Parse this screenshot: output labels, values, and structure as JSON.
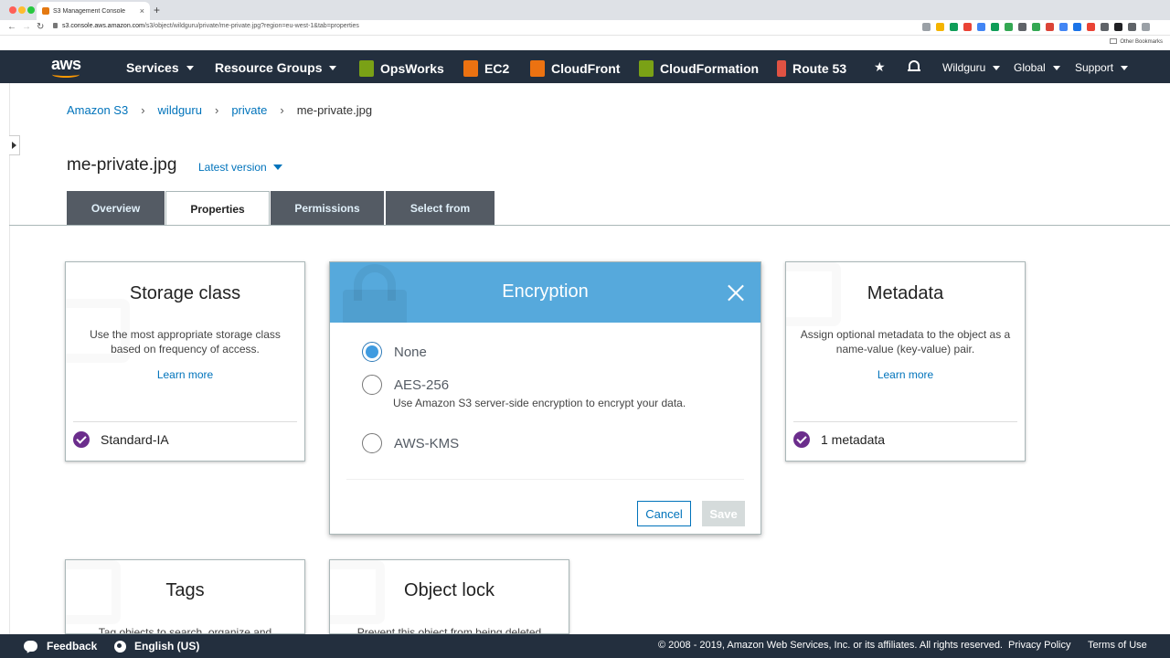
{
  "browser": {
    "tab_title": "S3 Management Console",
    "tab_close": "×",
    "new_tab": "+",
    "url_host": "s3.console.aws.amazon.com",
    "url_path": "/s3/object/wildguru/private/me-private.jpg?region=eu-west-1&tab=properties",
    "other_bookmarks": "Other Bookmarks",
    "extension_colors": [
      "#9aa0a6",
      "#f4b400",
      "#0f9d58",
      "#ea4335",
      "#4285f4",
      "#0f9d58",
      "#34a853",
      "#5f6368",
      "#34a853",
      "#db4437",
      "#4285f4",
      "#1a73e8",
      "#ea4335",
      "#5f6368",
      "#202124",
      "#5f6368",
      "#9aa0a6"
    ]
  },
  "aws_nav": {
    "logo": "aws",
    "items": [
      {
        "label": "Services",
        "caret": true
      },
      {
        "label": "Resource Groups",
        "caret": true
      },
      {
        "label": "OpsWorks",
        "icon": "opsworks-icon",
        "color": "#7aa116"
      },
      {
        "label": "EC2",
        "icon": "ec2-icon",
        "color": "#ec7211"
      },
      {
        "label": "CloudFront",
        "icon": "cloudfront-icon",
        "color": "#ec7211"
      },
      {
        "label": "CloudFormation",
        "icon": "cloudformation-icon",
        "color": "#7aa116"
      },
      {
        "label": "Route 53",
        "icon": "route53-icon",
        "color": "#e05243"
      }
    ],
    "account": "Wildguru",
    "region": "Global",
    "support": "Support"
  },
  "breadcrumb": {
    "items": [
      "Amazon S3",
      "wildguru",
      "private"
    ],
    "separator": "›",
    "current": "me-private.jpg"
  },
  "object": {
    "name": "me-private.jpg",
    "version": "Latest version"
  },
  "tabs": [
    {
      "label": "Overview",
      "active": false
    },
    {
      "label": "Properties",
      "active": true
    },
    {
      "label": "Permissions",
      "active": false
    },
    {
      "label": "Select from",
      "active": false
    }
  ],
  "storage_class": {
    "title": "Storage class",
    "description": "Use the most appropriate storage class based on frequency of access.",
    "link": "Learn more",
    "status": "Standard-IA"
  },
  "metadata": {
    "title": "Metadata",
    "description": "Assign optional metadata to the object as a name-value (key-value) pair.",
    "link": "Learn more",
    "status": "1 metadata"
  },
  "tags": {
    "title": "Tags",
    "description": "Tag objects to search, organize and"
  },
  "object_lock": {
    "title": "Object lock",
    "description": "Prevent this object from being deleted"
  },
  "encryption_dialog": {
    "title": "Encryption",
    "options": [
      {
        "label": "None",
        "checked": true
      },
      {
        "label": "AES-256",
        "checked": false,
        "description": "Use Amazon S3 server-side encryption to encrypt your data."
      },
      {
        "label": "AWS-KMS",
        "checked": false
      }
    ],
    "cancel": "Cancel",
    "save": "Save",
    "header_color": "#56a9dc"
  },
  "footer": {
    "feedback": "Feedback",
    "language": "English (US)",
    "copyright": "© 2008 - 2019, Amazon Web Services, Inc. or its affiliates. All rights reserved.",
    "privacy": "Privacy Policy",
    "terms": "Terms of Use"
  }
}
